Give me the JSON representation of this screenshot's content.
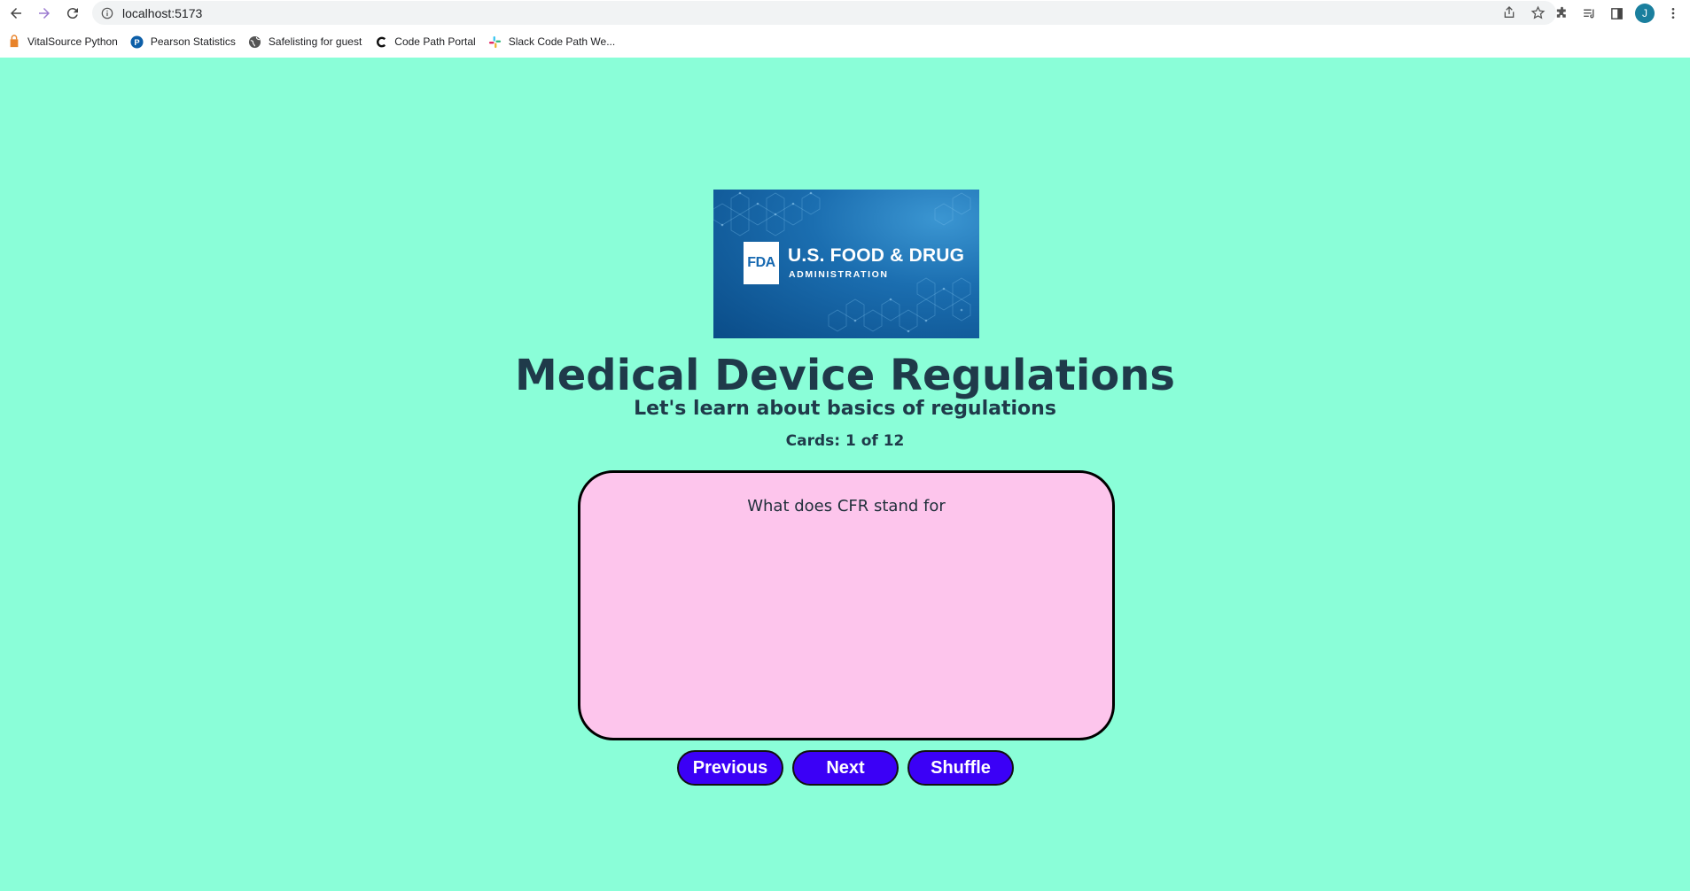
{
  "browser": {
    "url": "localhost:5173",
    "profile_initial": "J",
    "bookmarks": [
      {
        "label": "VitalSource Python",
        "icon": "vitalsource-icon"
      },
      {
        "label": "Pearson Statistics",
        "icon": "pearson-icon"
      },
      {
        "label": "Safelisting for guest",
        "icon": "globe-icon"
      },
      {
        "label": "Code Path Portal",
        "icon": "codepath-icon"
      },
      {
        "label": "Slack Code Path We...",
        "icon": "slack-icon"
      }
    ]
  },
  "logo": {
    "mark": "FDA",
    "line1": "U.S. FOOD & DRUG",
    "line2": "ADMINISTRATION"
  },
  "header": {
    "title": "Medical Device Regulations",
    "subtitle": "Let's learn about basics of regulations",
    "counter": "Cards: 1 of 12"
  },
  "card": {
    "text": "What does CFR stand for"
  },
  "controls": {
    "previous_label": "Previous",
    "next_label": "Next",
    "shuffle_label": "Shuffle"
  },
  "colors": {
    "page_background": "#8afed8",
    "card_background": "#fdc5ec",
    "button_background": "#3b00f6",
    "heading_text": "#1f3a4a"
  }
}
